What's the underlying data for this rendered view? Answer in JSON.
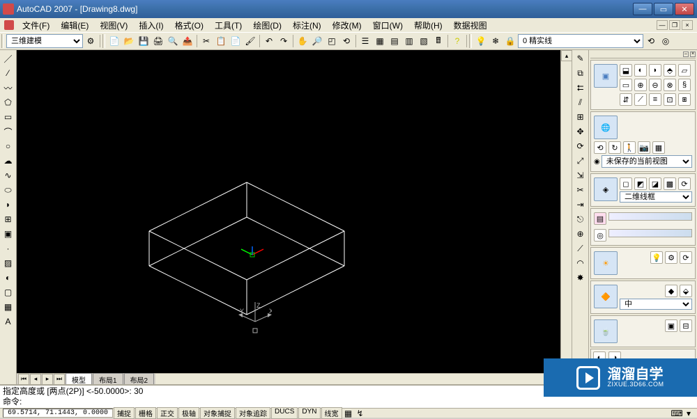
{
  "title": "AutoCAD 2007 - [Drawing8.dwg]",
  "menus": [
    "文件(F)",
    "编辑(E)",
    "视图(V)",
    "插入(I)",
    "格式(O)",
    "工具(T)",
    "绘图(D)",
    "标注(N)",
    "修改(M)",
    "窗口(W)",
    "帮助(H)",
    "数据视图"
  ],
  "workspace_select": "三维建模",
  "layer_select": "0 精实线",
  "panel": {
    "view_saved": "未保存的当前视图",
    "visual_style": "二维线框",
    "material_select": "中"
  },
  "command": {
    "line1": "指定高度或 [两点(2P)] <-50.0000>: 30",
    "line2": "命令:"
  },
  "status": {
    "coords": "69.5714, 71.1443, 0.0000",
    "buttons": [
      "捕捉",
      "栅格",
      "正交",
      "极轴",
      "对象捕捉",
      "对象追踪",
      "DUCS",
      "DYN",
      "线宽"
    ]
  },
  "canvas_tabs": [
    "模型",
    "布局1",
    "布局2"
  ],
  "axes": {
    "x": "X",
    "y": "Y",
    "z": "Z"
  },
  "watermark": {
    "main": "溜溜自学",
    "sub": "ZIXUE.3D66.COM"
  }
}
